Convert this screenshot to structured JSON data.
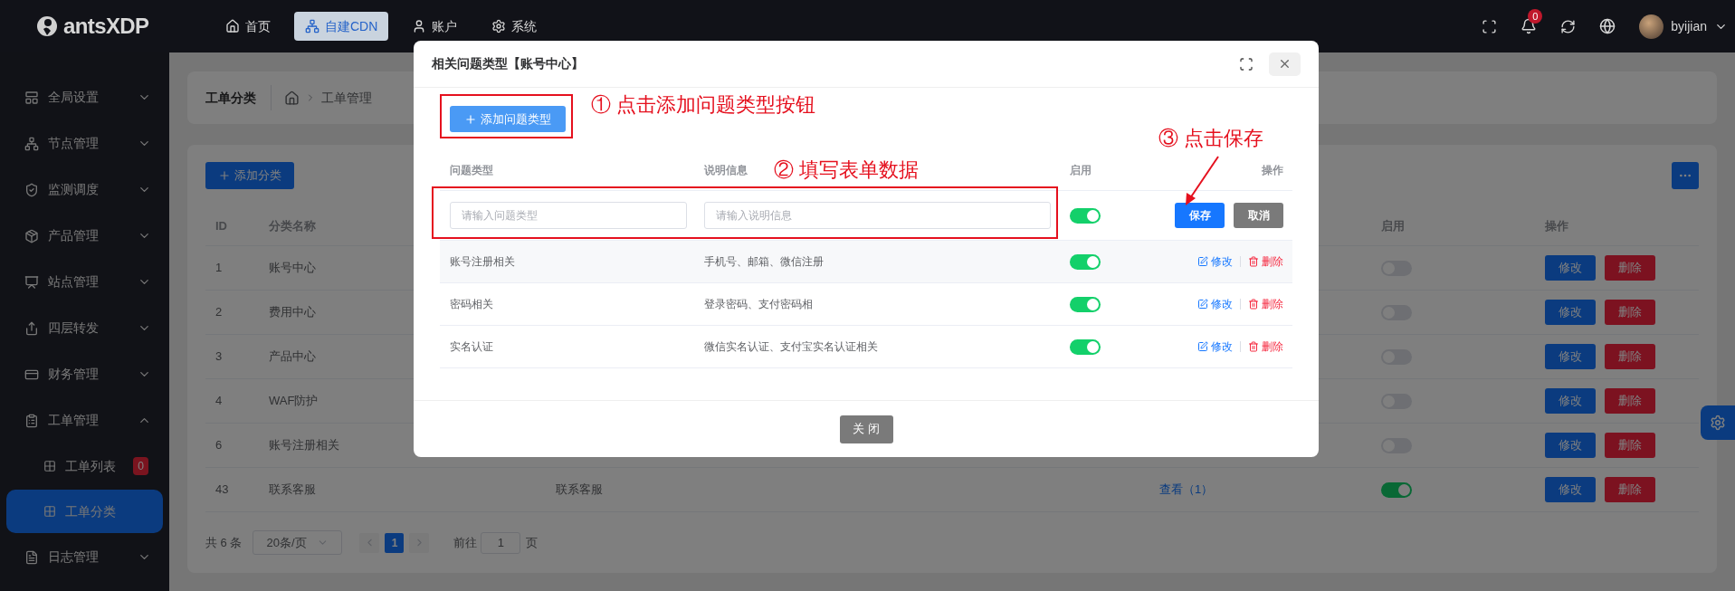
{
  "header": {
    "logo": "antsXDP",
    "nav": [
      {
        "label": "首页",
        "selected": false
      },
      {
        "label": "自建CDN",
        "selected": true
      },
      {
        "label": "账户",
        "selected": false
      },
      {
        "label": "系统",
        "selected": false
      }
    ],
    "notifications": "0",
    "user": "byijian"
  },
  "sidebar": {
    "items": [
      {
        "label": "全局设置",
        "expanded": false
      },
      {
        "label": "节点管理",
        "expanded": false
      },
      {
        "label": "监测调度",
        "expanded": false
      },
      {
        "label": "产品管理",
        "expanded": false
      },
      {
        "label": "站点管理",
        "expanded": false
      },
      {
        "label": "四层转发",
        "expanded": false
      },
      {
        "label": "财务管理",
        "expanded": false
      },
      {
        "label": "工单管理",
        "expanded": true,
        "children": [
          {
            "label": "工单列表",
            "badge": "0",
            "selected": false
          },
          {
            "label": "工单分类",
            "selected": true
          }
        ]
      },
      {
        "label": "日志管理",
        "expanded": false
      }
    ]
  },
  "page": {
    "title": "工单分类",
    "breadcrumb": [
      "工单管理"
    ],
    "add_button": "添加分类",
    "table": {
      "columns": {
        "id": "ID",
        "name": "分类名称",
        "enabled": "启用",
        "actions": "操作"
      },
      "rows": [
        {
          "id": "1",
          "name": "账号中心",
          "enabled": false,
          "actions": [
            "修改",
            "删除"
          ]
        },
        {
          "id": "2",
          "name": "费用中心",
          "enabled": false,
          "actions": [
            "修改",
            "删除"
          ]
        },
        {
          "id": "3",
          "name": "产品中心",
          "enabled": false,
          "actions": [
            "修改",
            "删除"
          ]
        },
        {
          "id": "4",
          "name": "WAF防护",
          "enabled": false,
          "actions": [
            "修改",
            "删除"
          ]
        },
        {
          "id": "6",
          "name": "账号注册相关",
          "enabled": false,
          "actions": [
            "修改",
            "删除"
          ]
        },
        {
          "id": "43",
          "name": "联系客服",
          "column_3": "联系客服",
          "column_4": "查看（1）",
          "enabled": true,
          "actions": [
            "修改",
            "删除"
          ]
        }
      ]
    },
    "pagination": {
      "total": "共 6 条",
      "page_size": "20条/页",
      "pages": [
        {
          "label": "1",
          "selected": true
        }
      ],
      "goto_label": "前往",
      "goto_value": "1",
      "goto_suffix": "页"
    }
  },
  "modal": {
    "title": "相关问题类型【账号中心】",
    "add_button": "添加问题类型",
    "columns": [
      "问题类型",
      "说明信息",
      "启用",
      "操作"
    ],
    "new_row": {
      "type_placeholder": "请输入问题类型",
      "description_placeholder": "请输入说明信息",
      "enabled": true,
      "save": "保存",
      "cancel": "取消"
    },
    "rows": [
      {
        "type": "账号注册相关",
        "description": "手机号、邮箱、微信注册",
        "enabled": true,
        "actions": [
          "修改",
          "删除"
        ]
      },
      {
        "type": "密码相关",
        "description": "登录密码、支付密码相",
        "enabled": true,
        "actions": [
          "修改",
          "删除"
        ]
      },
      {
        "type": "实名认证",
        "description": "微信实名认证、支付宝实名认证相关",
        "enabled": true,
        "actions": [
          "修改",
          "删除"
        ]
      }
    ],
    "close_button": "关 闭",
    "annotations": [
      "① 点击添加问题类型按钮",
      "② 填写表单数据",
      "③ 点击保存"
    ]
  }
}
